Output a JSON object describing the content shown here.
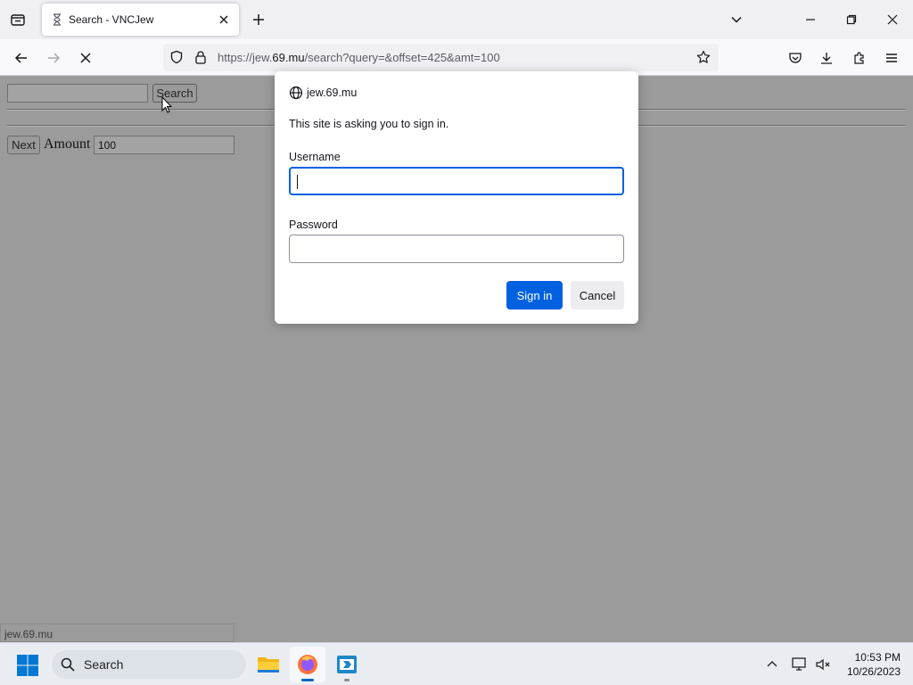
{
  "browser": {
    "tab": {
      "title": "Search - VNCJew"
    },
    "url": {
      "prefix": "https://jew.",
      "domain": "69.mu",
      "path": "/search?query=&offset=425&amt=100"
    }
  },
  "page": {
    "search_button_label": "Search",
    "search_value": "",
    "next_button_label": "Next",
    "amount_label": "Amount",
    "amount_value": "100",
    "status_text": "jew.69.mu"
  },
  "dialog": {
    "origin": "jew.69.mu",
    "message": "This site is asking you to sign in.",
    "username_label": "Username",
    "username_value": "",
    "password_label": "Password",
    "password_value": "",
    "sign_in_label": "Sign in",
    "cancel_label": "Cancel"
  },
  "taskbar": {
    "search_placeholder": "Search",
    "time": "10:53 PM",
    "date": "10/26/2023"
  },
  "colors": {
    "accent": "#0061e0",
    "page_background": "#9b9b9b",
    "taskbar": "#e9edf2"
  }
}
